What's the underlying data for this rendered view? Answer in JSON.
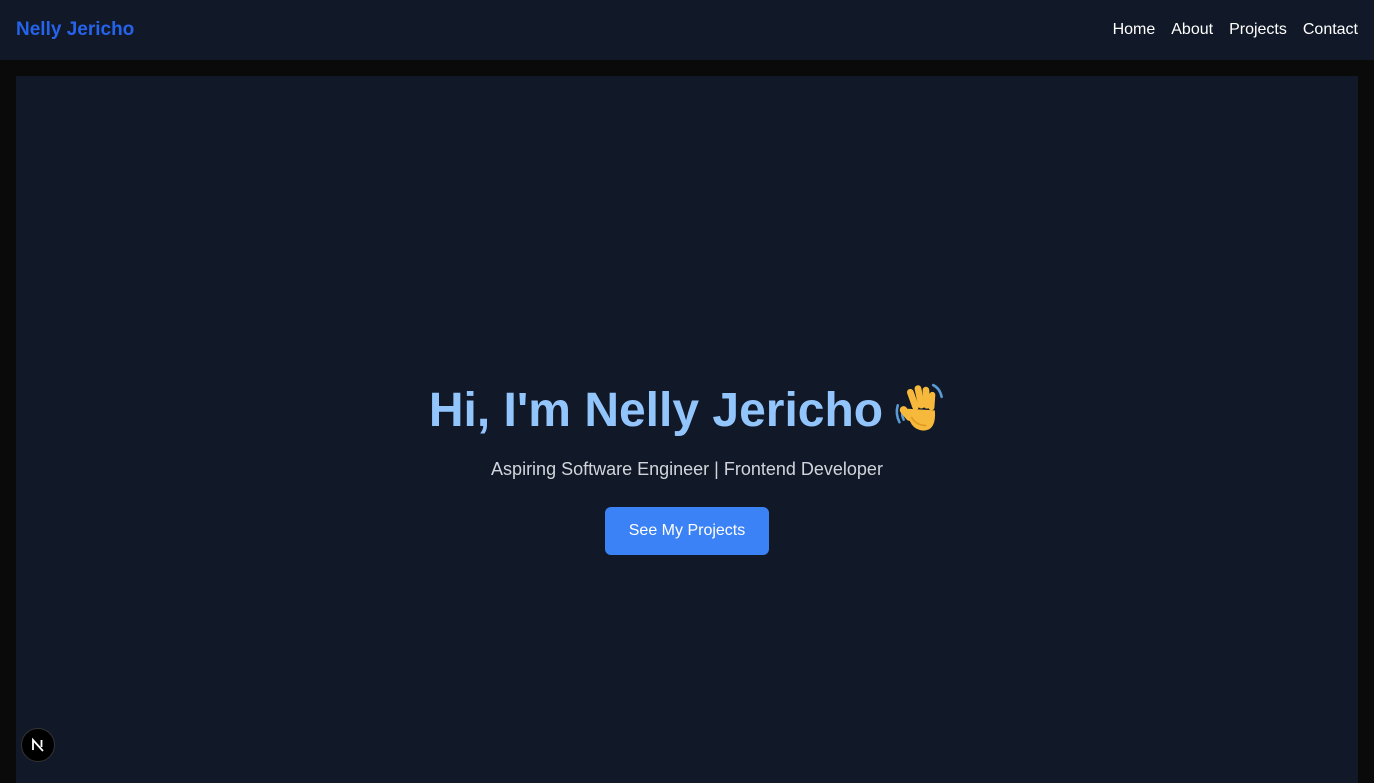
{
  "navbar": {
    "brand": "Nelly Jericho",
    "links": [
      "Home",
      "About",
      "Projects",
      "Contact"
    ]
  },
  "hero": {
    "title": "Hi, I'm Nelly Jericho",
    "title_icon": "waving-hand-icon",
    "subtitle": "Aspiring Software Engineer | Frontend Developer",
    "cta_label": "See My Projects"
  },
  "dev_badge": {
    "icon": "nextjs-logo-icon",
    "letter": "N"
  },
  "colors": {
    "page_bg": "#0a0a0a",
    "surface": "#111827",
    "brand": "#2563eb",
    "title": "#93c5fd",
    "subtitle": "#d1d5db",
    "button": "#3b82f6",
    "nav_text": "#ffffff"
  }
}
